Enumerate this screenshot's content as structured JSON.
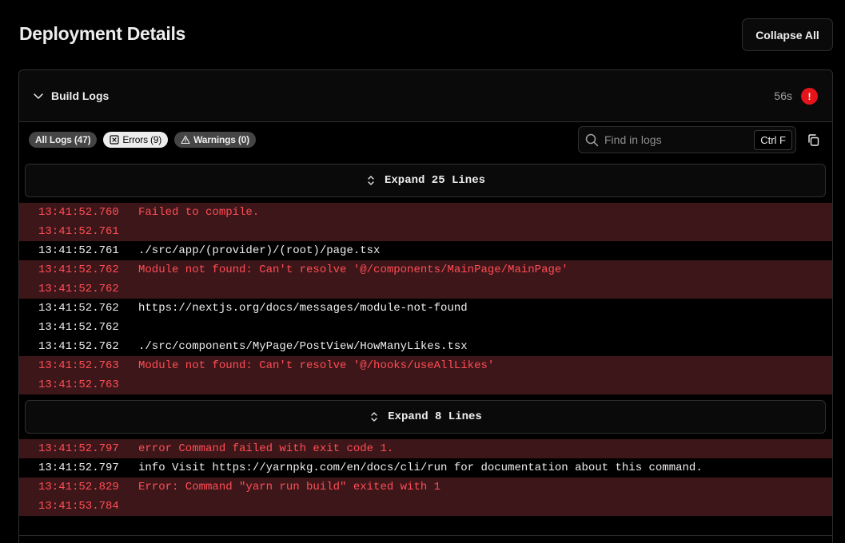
{
  "page": {
    "title": "Deployment Details",
    "collapse_label": "Collapse All"
  },
  "panel": {
    "title": "Build Logs",
    "duration": "56s",
    "error_badge": "!",
    "filters": {
      "all": "All Logs (47)",
      "errors": "Errors (9)",
      "warnings": "Warnings (0)"
    },
    "search": {
      "placeholder": "Find in logs",
      "shortcut": "Ctrl F"
    },
    "expand_top": "Expand 25 Lines",
    "expand_mid": "Expand 8 Lines",
    "logs_a": [
      {
        "ts": "13:41:52.760",
        "msg": "Failed to compile.",
        "level": "err"
      },
      {
        "ts": "13:41:52.761",
        "msg": "",
        "level": "err"
      },
      {
        "ts": "13:41:52.761",
        "msg": "./src/app/(provider)/(root)/page.tsx",
        "level": "info"
      },
      {
        "ts": "13:41:52.762",
        "msg": "Module not found: Can't resolve '@/components/MainPage/MainPage'",
        "level": "err"
      },
      {
        "ts": "13:41:52.762",
        "msg": "",
        "level": "err"
      },
      {
        "ts": "13:41:52.762",
        "msg": "https://nextjs.org/docs/messages/module-not-found",
        "level": "info"
      },
      {
        "ts": "13:41:52.762",
        "msg": "",
        "level": "info"
      },
      {
        "ts": "13:41:52.762",
        "msg": "./src/components/MyPage/PostView/HowManyLikes.tsx",
        "level": "info"
      },
      {
        "ts": "13:41:52.763",
        "msg": "Module not found: Can't resolve '@/hooks/useAllLikes'",
        "level": "err"
      },
      {
        "ts": "13:41:52.763",
        "msg": "",
        "level": "err"
      }
    ],
    "logs_b": [
      {
        "ts": "13:41:52.797",
        "msg": "error Command failed with exit code 1.",
        "level": "err"
      },
      {
        "ts": "13:41:52.797",
        "msg": "info Visit https://yarnpkg.com/en/docs/cli/run for documentation about this command.",
        "level": "info"
      },
      {
        "ts": "13:41:52.829",
        "msg": "Error: Command \"yarn run build\" exited with 1",
        "level": "err"
      },
      {
        "ts": "13:41:53.784",
        "msg": "",
        "level": "err"
      }
    ]
  }
}
